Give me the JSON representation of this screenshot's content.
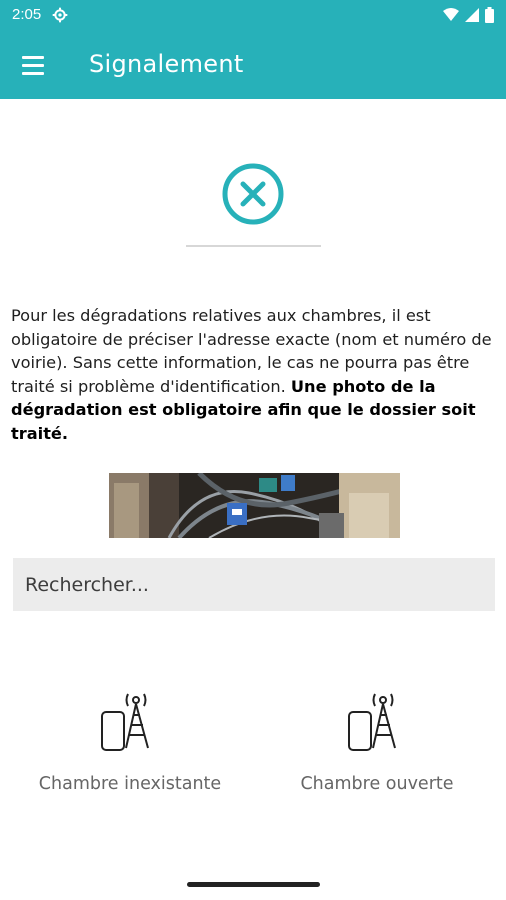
{
  "status_bar": {
    "time": "2:05",
    "icons": [
      "settings-gear-icon",
      "wifi-icon",
      "cellular-signal-icon",
      "battery-icon"
    ]
  },
  "app_bar": {
    "title": "Signalement",
    "menu_icon": "hamburger-menu-icon"
  },
  "main": {
    "close_icon": "circle-close-icon",
    "info_text_normal": "Pour les dégradations relatives aux chambres, il est obligatoire de préciser l'adresse exacte (nom et numéro de voirie). Sans cette information, le cas ne pourra pas être traité si problème d'identification. ",
    "info_text_bold": "Une photo de la dégradation est obligatoire afin que le dossier soit traité.",
    "search": {
      "placeholder": "Rechercher...",
      "value": ""
    },
    "options": [
      {
        "label": "Chambre inexistante",
        "icon": "phone-antenna-icon"
      },
      {
        "label": "Chambre ouverte",
        "icon": "phone-antenna-icon"
      }
    ]
  },
  "colors": {
    "accent": "#27b1b9",
    "text": "#1f1f1f",
    "muted": "#666666",
    "search_bg": "#ececec"
  }
}
